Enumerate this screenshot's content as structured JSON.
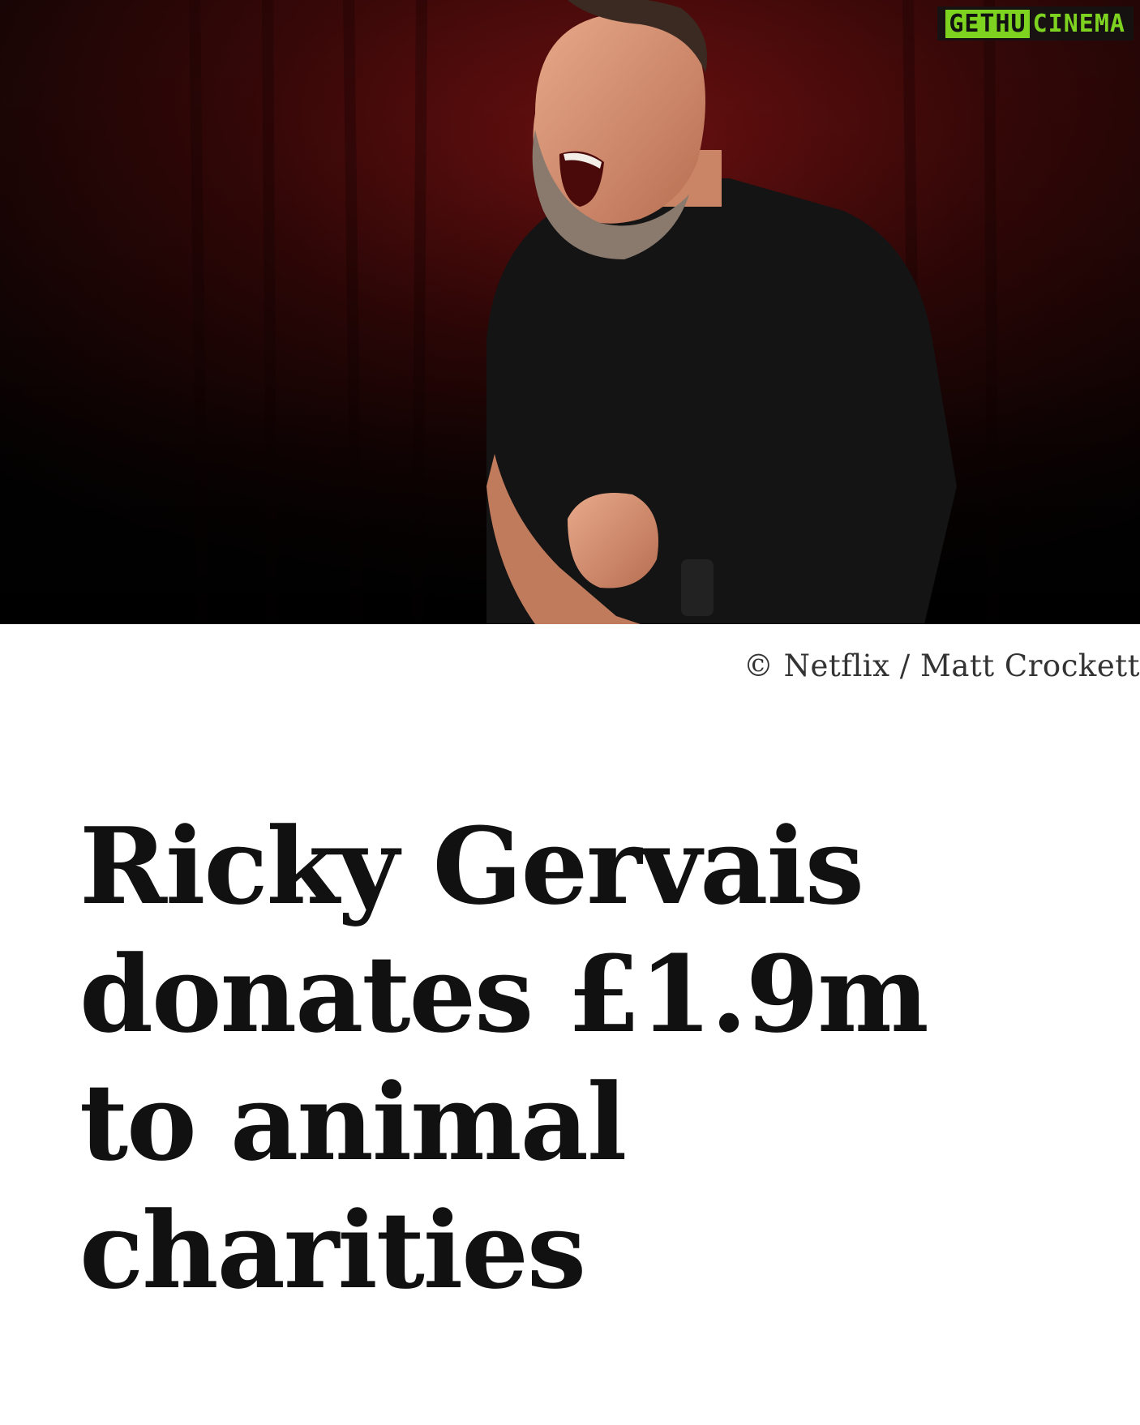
{
  "watermark": {
    "part1": "GETHU",
    "part2": "CINEMA"
  },
  "photo": {
    "subject": "comedian on stage shouting with clenched fist in front of dark red curtain",
    "background_color": "#0a0606",
    "curtain_color": "#5a0c0c"
  },
  "credit": "© Netflix / Matt Crockett",
  "headline": {
    "line1": "Ricky Gervais",
    "line2": "donates £1.9m",
    "line3": "to animal",
    "line4": "charities"
  }
}
